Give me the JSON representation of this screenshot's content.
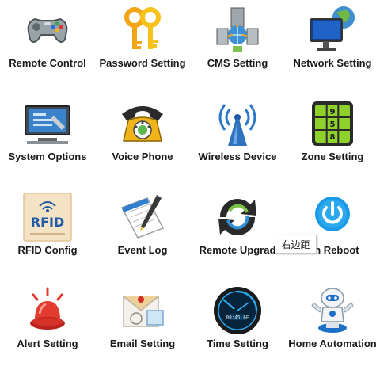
{
  "menu": {
    "items": [
      {
        "label": "Remote Control",
        "icon": "gamepad-icon"
      },
      {
        "label": "Password Setting",
        "icon": "keys-icon"
      },
      {
        "label": "CMS Setting",
        "icon": "cms-network-icon"
      },
      {
        "label": "Network Setting",
        "icon": "globe-monitor-icon"
      },
      {
        "label": "System Options",
        "icon": "system-options-icon"
      },
      {
        "label": "Voice Phone",
        "icon": "phone-icon"
      },
      {
        "label": "Wireless Device",
        "icon": "antenna-icon"
      },
      {
        "label": "Zone Setting",
        "icon": "keypad-icon"
      },
      {
        "label": "RFID Config",
        "icon": "rfid-icon"
      },
      {
        "label": "Event Log",
        "icon": "notebook-pen-icon"
      },
      {
        "label": "Remote Upgrad",
        "icon": "sync-arrows-icon"
      },
      {
        "label": "em Reboot",
        "icon": "power-button-icon"
      },
      {
        "label": "Alert Setting",
        "icon": "siren-icon"
      },
      {
        "label": "Email Setting",
        "icon": "envelope-icon"
      },
      {
        "label": "Time Setting",
        "icon": "clock-icon"
      },
      {
        "label": "Home Automation",
        "icon": "robot-icon"
      }
    ]
  },
  "tooltip": {
    "text": "右边距"
  },
  "icon_texts": {
    "rfid": "RFID",
    "clock_time": "00:45 6E",
    "keypad": [
      "9",
      "5",
      "8"
    ]
  }
}
